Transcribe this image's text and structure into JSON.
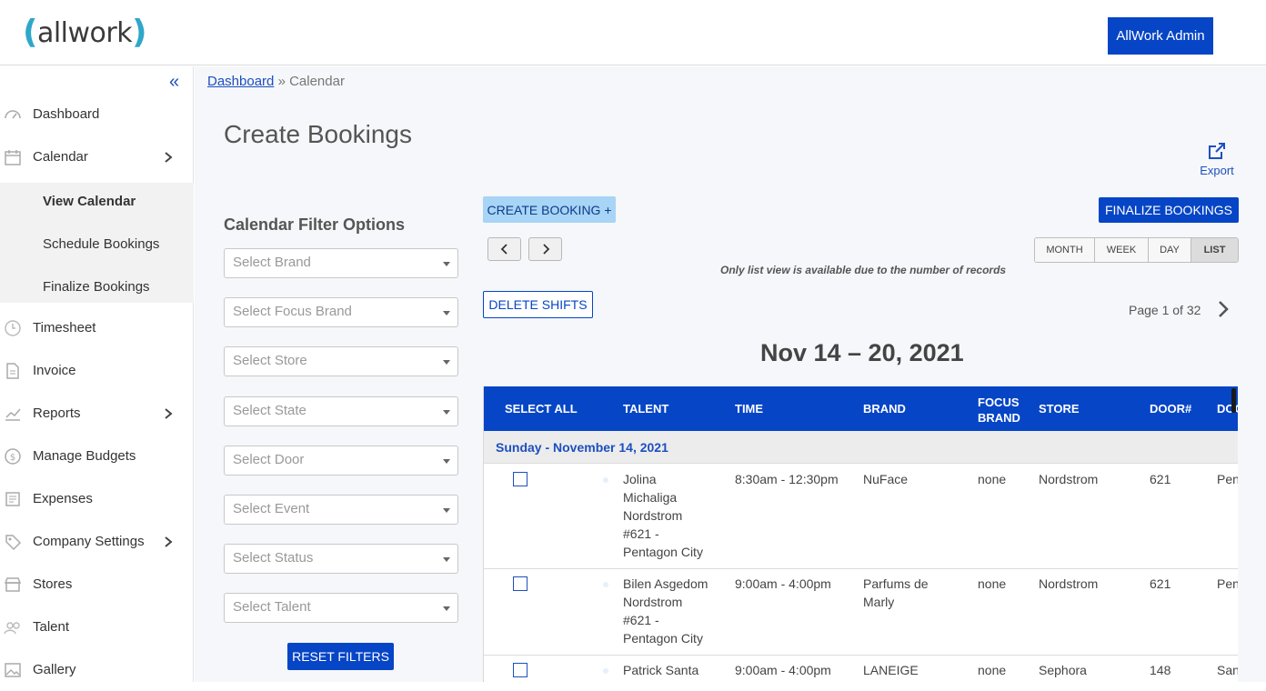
{
  "app": {
    "logo": "allwork",
    "admin_button": "AllWork Admin"
  },
  "sidebar": {
    "items": [
      {
        "label": "Dashboard",
        "icon": "gauge-icon"
      },
      {
        "label": "Calendar",
        "icon": "calendar-icon",
        "expandable": true
      },
      {
        "label": "Timesheet",
        "icon": "clock-icon"
      },
      {
        "label": "Invoice",
        "icon": "document-icon"
      },
      {
        "label": "Reports",
        "icon": "chart-icon",
        "expandable": true
      },
      {
        "label": "Manage Budgets",
        "icon": "money-icon"
      },
      {
        "label": "Expenses",
        "icon": "receipt-icon"
      },
      {
        "label": "Company Settings",
        "icon": "tag-icon",
        "expandable": true
      },
      {
        "label": "Stores",
        "icon": "store-icon"
      },
      {
        "label": "Talent",
        "icon": "people-icon"
      },
      {
        "label": "Gallery",
        "icon": "image-icon"
      }
    ],
    "calendar_submenu": [
      "View Calendar",
      "Schedule Bookings",
      "Finalize Bookings"
    ]
  },
  "breadcrumb": {
    "root": "Dashboard",
    "current": "» Calendar"
  },
  "page_title": "Create Bookings",
  "export_label": "Export",
  "filters": {
    "title": "Calendar Filter Options",
    "placeholders": [
      "Select Brand",
      "Select Focus Brand",
      "Select Store",
      "Select State",
      "Select Door",
      "Select Event",
      "Select Status",
      "Select Talent"
    ],
    "reset_label": "RESET FILTERS"
  },
  "toolbar": {
    "create_label": "CREATE BOOKING +",
    "finalize_label": "FINALIZE BOOKINGS",
    "views": [
      "MONTH",
      "WEEK",
      "DAY",
      "LIST"
    ],
    "active_view": "LIST",
    "list_note": "Only list view is available due to the number of records",
    "delete_label": "DELETE SHIFTS",
    "page_info": "Page 1 of 32"
  },
  "date_range": "Nov 14 – 20, 2021",
  "table": {
    "headers": [
      "SELECT ALL",
      "TALENT",
      "TIME",
      "BRAND",
      "FOCUS BRAND",
      "STORE",
      "DOOR#",
      "DOO"
    ],
    "group_label": "Sunday - November 14, 2021",
    "rows": [
      {
        "talent": [
          "Jolina",
          "Michaliga",
          "Nordstrom",
          "#621 -",
          "Pentagon City"
        ],
        "time": "8:30am - 12:30pm",
        "brand": [
          "NuFace"
        ],
        "focus": "none",
        "store": "Nordstrom",
        "door": "621",
        "extra": "Pen"
      },
      {
        "talent": [
          "Bilen Asgedom",
          "Nordstrom",
          "#621 -",
          "Pentagon City"
        ],
        "time": "9:00am - 4:00pm",
        "brand": [
          "Parfums de",
          "Marly"
        ],
        "focus": "none",
        "store": "Nordstrom",
        "door": "621",
        "extra": "Pen"
      },
      {
        "talent": [
          "Patrick Santa"
        ],
        "time": "9:00am - 4:00pm",
        "brand": [
          "LANEIGE"
        ],
        "focus": "none",
        "store": "Sephora",
        "door": "148",
        "extra": "San"
      }
    ]
  }
}
